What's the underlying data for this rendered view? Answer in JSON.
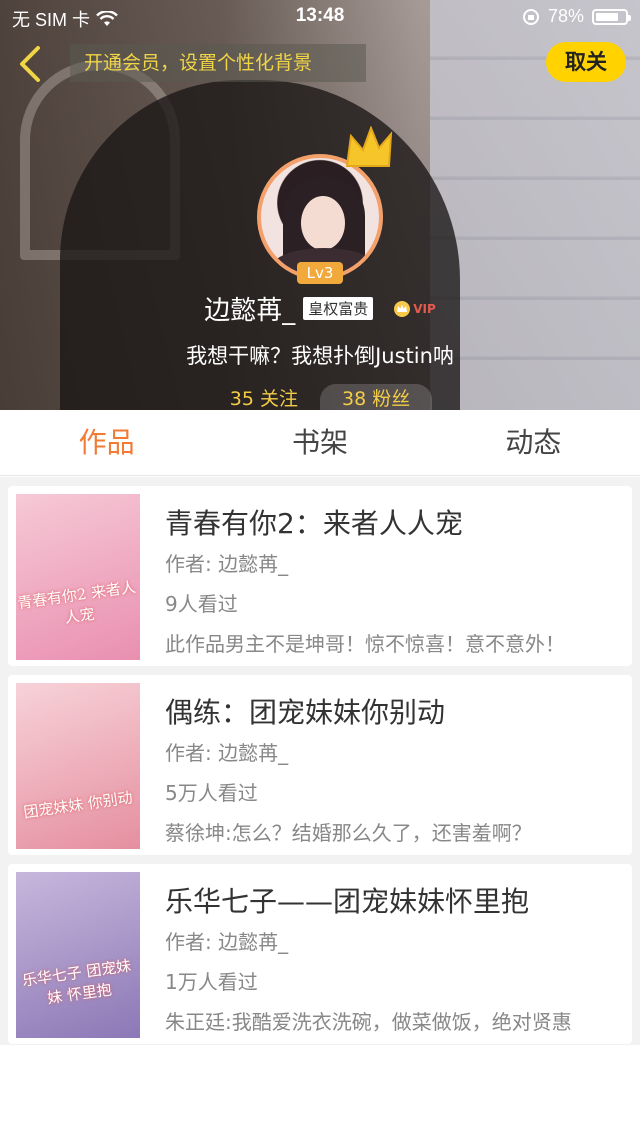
{
  "status_bar": {
    "carrier": "无 SIM 卡",
    "time": "13:48",
    "battery": "78%",
    "battery_level": 0.78
  },
  "header": {
    "banner": "开通会员，设置个性化背景",
    "unfollow_label": "取关",
    "level": "Lv3",
    "username": "边懿苒_",
    "title_tag": "皇权富贵",
    "vip_label": "VIP",
    "signature": "我想干嘛？我想扑倒Justin呐",
    "following": "35 关注",
    "followers": "38 粉丝"
  },
  "tabs": [
    {
      "label": "作品",
      "active": true
    },
    {
      "label": "书架",
      "active": false
    },
    {
      "label": "动态",
      "active": false
    }
  ],
  "books": [
    {
      "title": "青春有你2：来者人人宠",
      "author": "作者: 边懿苒_",
      "views": "9人看过",
      "desc": "此作品男主不是坤哥！惊不惊喜！意不意外！",
      "cover_text": "青春有你2 来者人人宠",
      "cover_colors": [
        "#f6c9d6",
        "#e98fb0"
      ]
    },
    {
      "title": "偶练：团宠妹妹你别动",
      "author": "作者: 边懿苒_",
      "views": "5万人看过",
      "desc": "蔡徐坤:怎么？结婚那么久了，还害羞啊？",
      "cover_text": "团宠妹妹 你别动",
      "cover_colors": [
        "#f7d2d8",
        "#e58fa0"
      ]
    },
    {
      "title": "乐华七子——团宠妹妹怀里抱",
      "author": "作者: 边懿苒_",
      "views": "1万人看过",
      "desc": "朱正廷:我酷爱洗衣洗碗，做菜做饭，绝对贤惠",
      "cover_text": "乐华七子 团宠妹妹 怀里抱",
      "cover_colors": [
        "#c7b7dc",
        "#8c78b6"
      ]
    }
  ],
  "colors": {
    "accent": "#f27a33",
    "banner_text": "#f1d546",
    "unfollow_bg": "#ffd200",
    "stats": "#f4cd47"
  }
}
